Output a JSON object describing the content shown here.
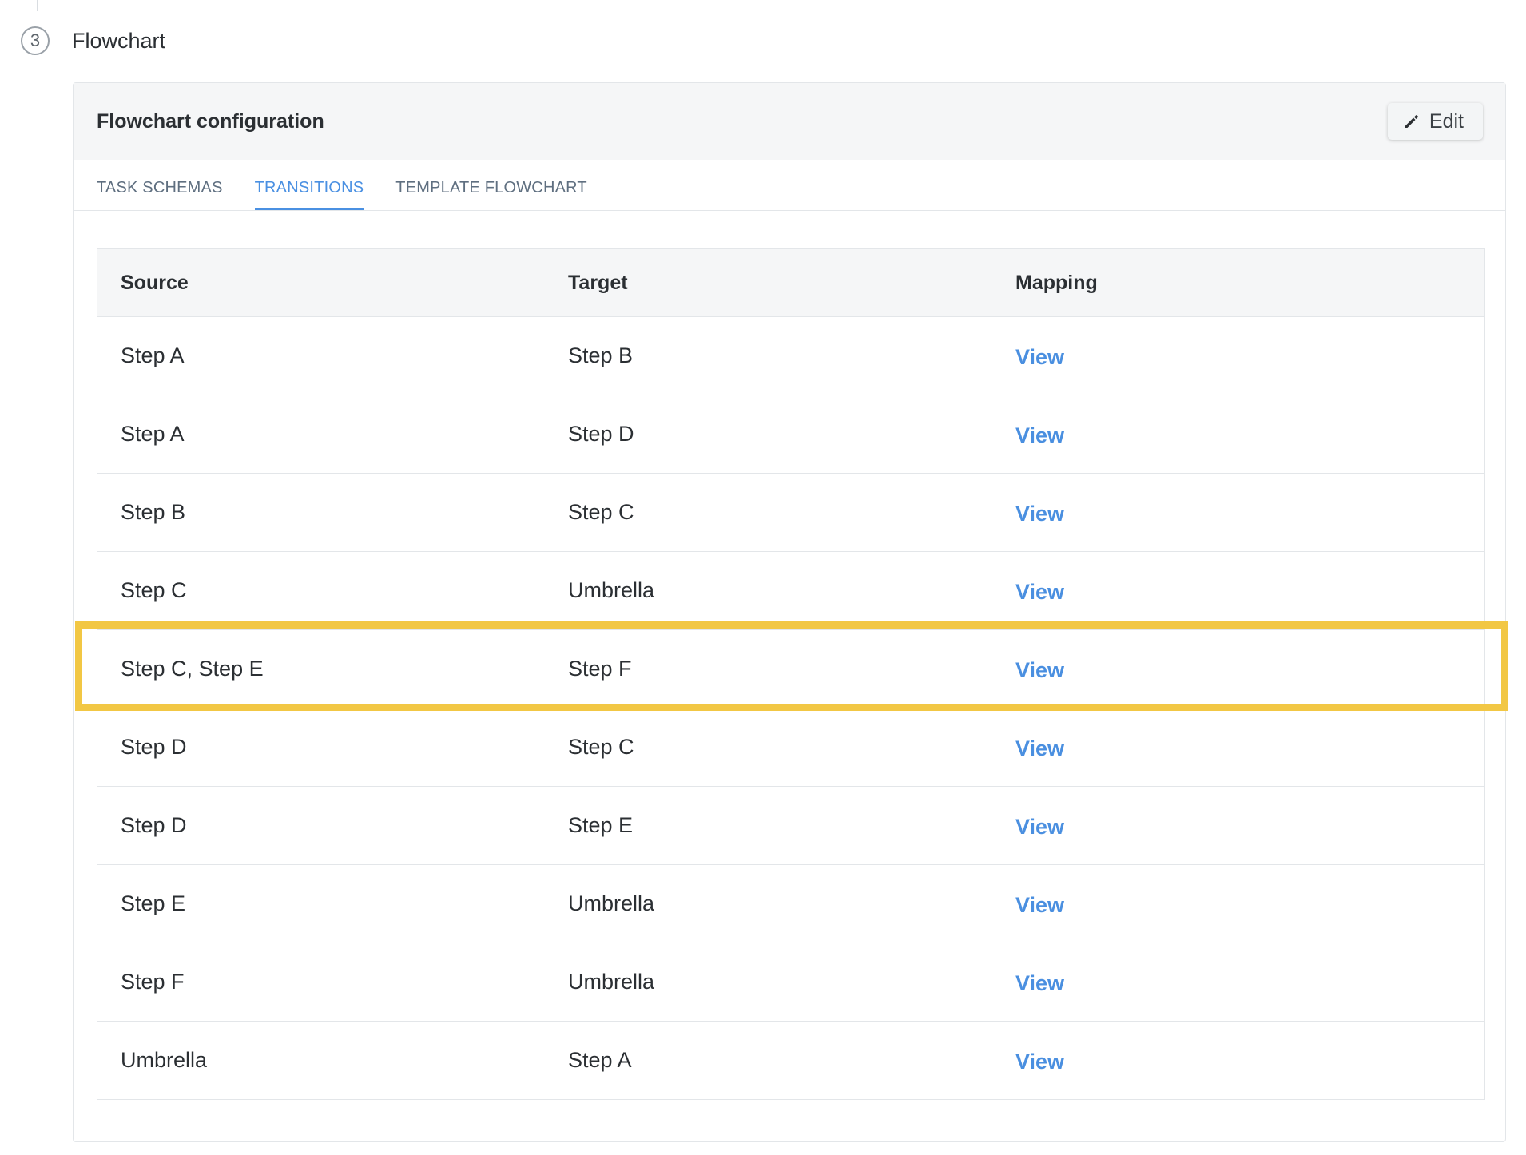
{
  "step": {
    "number": "3",
    "title": "Flowchart"
  },
  "card": {
    "title": "Flowchart configuration",
    "edit_label": "Edit"
  },
  "tabs": [
    {
      "label": "TASK SCHEMAS",
      "active": false
    },
    {
      "label": "TRANSITIONS",
      "active": true
    },
    {
      "label": "TEMPLATE FLOWCHART",
      "active": false
    }
  ],
  "table": {
    "headers": {
      "source": "Source",
      "target": "Target",
      "mapping": "Mapping"
    },
    "rows": [
      {
        "source": "Step A",
        "target": "Step B",
        "mapping": "View"
      },
      {
        "source": "Step A",
        "target": "Step D",
        "mapping": "View"
      },
      {
        "source": "Step B",
        "target": "Step C",
        "mapping": "View"
      },
      {
        "source": "Step C",
        "target": "Umbrella",
        "mapping": "View"
      },
      {
        "source": "Step C, Step E",
        "target": "Step F",
        "mapping": "View"
      },
      {
        "source": "Step D",
        "target": "Step C",
        "mapping": "View"
      },
      {
        "source": "Step D",
        "target": "Step E",
        "mapping": "View"
      },
      {
        "source": "Step E",
        "target": "Umbrella",
        "mapping": "View"
      },
      {
        "source": "Step F",
        "target": "Umbrella",
        "mapping": "View"
      },
      {
        "source": "Umbrella",
        "target": "Step A",
        "mapping": "View"
      }
    ]
  },
  "colors": {
    "accent": "#4a90e2",
    "highlight": "#f2c744"
  },
  "icons": {
    "edit": "pencil-icon"
  }
}
